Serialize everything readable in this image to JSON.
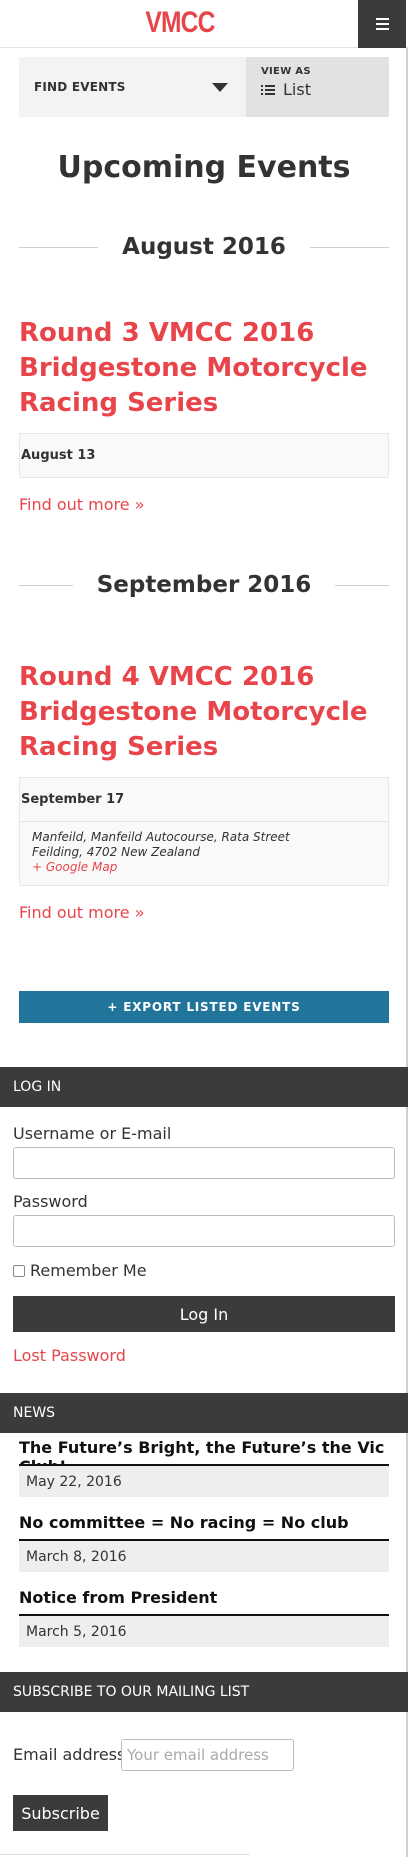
{
  "header": {
    "logo": "VMCC",
    "menu_icon": "hamburger-menu-icon"
  },
  "events_bar": {
    "find_events": "FIND EVENTS",
    "view_as_label": "VIEW AS",
    "view_as_value": "List",
    "list_icon": "list-icon",
    "dropdown_icon": "caret-down-icon"
  },
  "page_title": "Upcoming Events",
  "months": [
    {
      "label": "August 2016",
      "event": {
        "title": "Round 3 VMCC 2016 Bridgestone Motorcycle Racing Series",
        "date": "August 13",
        "find_more": "Find out more »"
      }
    },
    {
      "label": "September 2016",
      "event": {
        "title": "Round 4 VMCC 2016 Bridgestone Motorcycle Racing Series",
        "date": "September 17",
        "venue_line1": "Manfeild, Manfeild Autocourse, Rata Street",
        "venue_line2": "Feilding, 4702 New Zealand",
        "map_link": "+ Google Map",
        "find_more": "Find out more »"
      }
    }
  ],
  "export_label": "+ EXPORT LISTED EVENTS",
  "login": {
    "heading": "LOG IN",
    "username_label": "Username or E-mail",
    "username_value": "",
    "password_label": "Password",
    "password_value": "",
    "remember_label": "Remember Me",
    "remember_checked": false,
    "button": "Log In",
    "lost_password": "Lost Password"
  },
  "news": {
    "heading": "NEWS",
    "items": [
      {
        "title": "The Future’s Bright, the Future’s the Vic Club!",
        "date": "May 22, 2016"
      },
      {
        "title": "No committee = No racing = No club",
        "date": "March 8, 2016"
      },
      {
        "title": "Notice from President",
        "date": "March 5, 2016"
      }
    ]
  },
  "mailing": {
    "heading": "SUBSCRIBE TO OUR MAILING LIST",
    "email_label": "Email address:",
    "email_placeholder": "Your email address",
    "email_value": "",
    "button": "Subscribe"
  },
  "colors": {
    "accent": "#e8454b",
    "dark": "#3b3b3b",
    "export_blue": "#21759b"
  }
}
